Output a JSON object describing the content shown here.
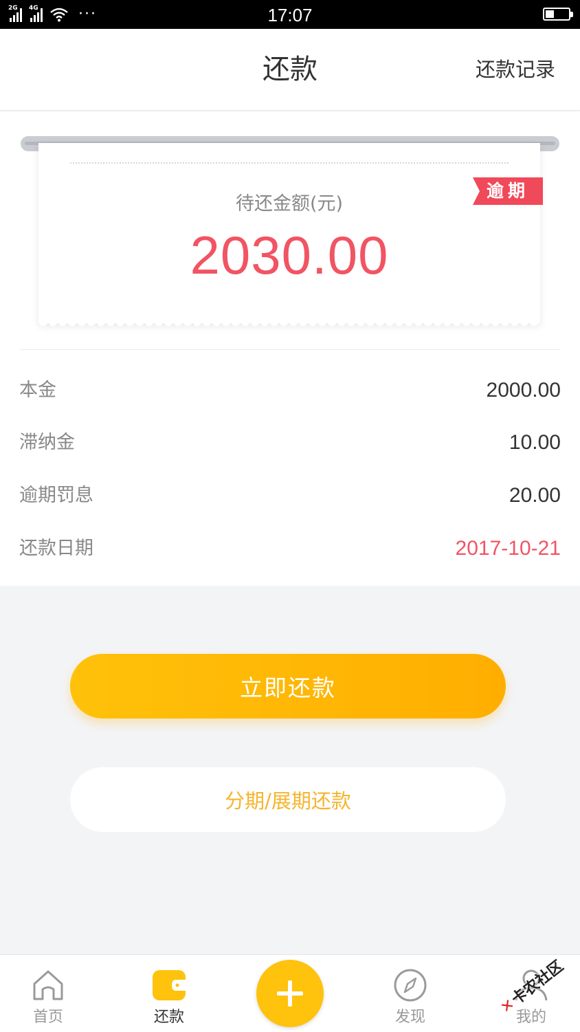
{
  "status_bar": {
    "time": "17:07",
    "sim1_tag": "2G",
    "sim2_tag": "4G",
    "more": "···"
  },
  "header": {
    "title": "还款",
    "record_link": "还款记录"
  },
  "ticket": {
    "label": "待还金额(元)",
    "amount": "2030.00",
    "overdue_tag": "逾期"
  },
  "details": [
    {
      "label": "本金",
      "value": "2000.00"
    },
    {
      "label": "滞纳金",
      "value": "10.00"
    },
    {
      "label": "逾期罚息",
      "value": "20.00"
    },
    {
      "label": "还款日期",
      "value": "2017-10-21"
    }
  ],
  "buttons": {
    "repay_now": "立即还款",
    "installment": "分期/展期还款"
  },
  "tabbar": {
    "items": [
      {
        "label": "首页",
        "icon": "home-icon"
      },
      {
        "label": "还款",
        "icon": "wallet-icon"
      },
      {
        "label": "",
        "icon": "plus-icon"
      },
      {
        "label": "发现",
        "icon": "compass-icon"
      },
      {
        "label": "我的",
        "icon": "user-icon"
      }
    ]
  },
  "watermark": "卡农社区",
  "colors": {
    "accent": "#ffc10a",
    "amount_red": "#f15463",
    "tag_red": "#f0495a",
    "secondary_text": "#f5b52e"
  }
}
